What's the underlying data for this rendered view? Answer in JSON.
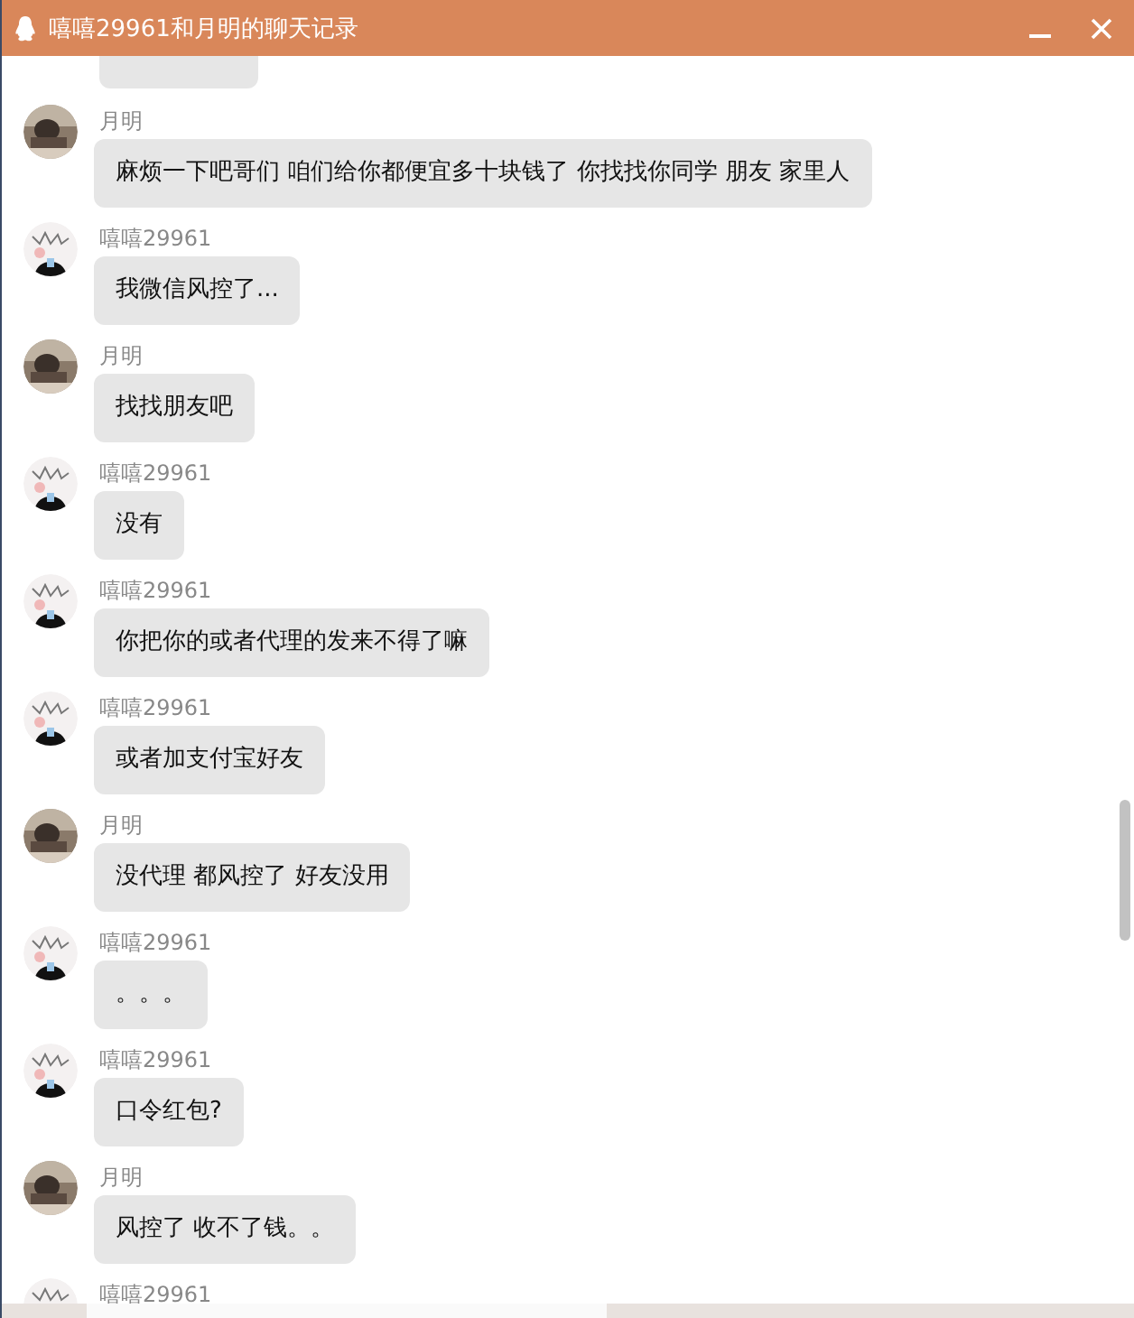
{
  "window": {
    "title": "嘻嘻29961和月明的聊天记录"
  },
  "messages": [
    {
      "sender": "月明",
      "text": "麻烦一下吧哥们 咱们给你都便宜多十块钱了 你找找你同学 朋友 家里人"
    },
    {
      "sender": "嘻嘻29961",
      "kind": "sketch",
      "text": "我微信风控了..."
    },
    {
      "sender": "月明",
      "text": "找找朋友吧"
    },
    {
      "sender": "嘻嘻29961",
      "kind": "sketch",
      "text": "没有"
    },
    {
      "sender": "嘻嘻29961",
      "kind": "sketch",
      "text": "你把你的或者代理的发来不得了嘛"
    },
    {
      "sender": "嘻嘻29961",
      "kind": "sketch",
      "text": "或者加支付宝好友"
    },
    {
      "sender": "月明",
      "text": "没代理 都风控了 好友没用"
    },
    {
      "sender": "嘻嘻29961",
      "kind": "sketch",
      "text": "。。。"
    },
    {
      "sender": "嘻嘻29961",
      "kind": "sketch",
      "text": "口令红包?"
    },
    {
      "sender": "月明",
      "text": "风控了 收不了钱。。"
    },
    {
      "sender": "嘻嘻29961",
      "kind": "sketch"
    }
  ]
}
